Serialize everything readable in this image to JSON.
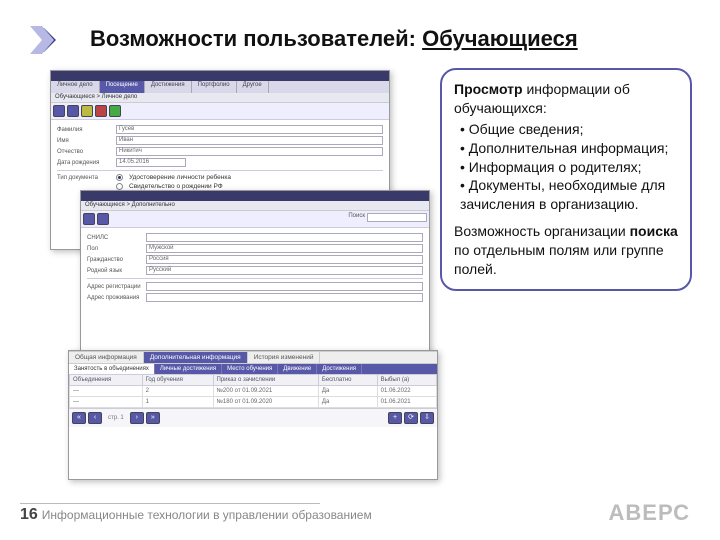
{
  "slide": {
    "title_prefix": "Возможности пользователей: ",
    "title_underline": "Обучающиеся",
    "page_num": "16",
    "footer_text": "Информационные технологии в управлении образованием",
    "logo": "АВЕРС"
  },
  "callout": {
    "p1_lead": "Просмотр",
    "p1_rest": " информации об обучающихся:",
    "bullets": [
      "Общие сведения;",
      "Дополнительная информация;",
      "Информация о родителях;",
      "Документы, необходимые для зачисления в организацию."
    ],
    "p2_a": "Возможность организации ",
    "p2_b": "поиска",
    "p2_c": " по отдельным полям или группе полей."
  },
  "win1": {
    "tabs": [
      "Личное дело",
      "Посещение",
      "Достижения",
      "Портфолио",
      "Другое"
    ],
    "breadcrumb": "Обучающиеся > Личное дело",
    "fields": {
      "surname_lbl": "Фамилия",
      "surname_val": "Гусев",
      "name_lbl": "Имя",
      "name_val": "Иван",
      "patr_lbl": "Отчество",
      "patr_val": "Никитич",
      "dob_lbl": "Дата рождения",
      "dob_val": "14.05.2016",
      "doc_r1": "Удостоверение личности ребенка",
      "doc_r2": "Свидетельство о рождении РФ",
      "doctype_lbl": "Тип документа"
    }
  },
  "win2": {
    "breadcrumb": "Обучающиеся > Дополнительно",
    "fields": {
      "snils_lbl": "СНИЛС",
      "snils_val": "",
      "sex_lbl": "Пол",
      "sex_val": "Мужской",
      "citiz_lbl": "Гражданство",
      "citiz_val": "Россия",
      "lang_lbl": "Родной язык",
      "lang_val": "Русский",
      "addr_lbl": "Адрес регистрации",
      "addr_val": "",
      "fact_lbl": "Адрес проживания",
      "fact_val": ""
    },
    "searchbox_lbl": "Поиск",
    "searchbox_val": ""
  },
  "win3": {
    "subtabs": [
      "Общая информация",
      "Дополнительная информация",
      "История изменений"
    ],
    "subtabs2": [
      "Занятость в объединениях",
      "Личные достижения",
      "Место обучения",
      "Движение",
      "Достижения"
    ],
    "grid": {
      "cols": [
        "Объединения",
        "Год обучения",
        "Приказ о зачислении",
        "Бесплатно",
        "Выбыл (а)"
      ],
      "rows": [
        [
          "—",
          "2",
          "№200 от 01.09.2021",
          "Да",
          "01.06.2022"
        ],
        [
          "—",
          "1",
          "№180 от 01.09.2020",
          "Да",
          "01.06.2021"
        ]
      ]
    },
    "pager": {
      "info": "стр. 1"
    }
  }
}
